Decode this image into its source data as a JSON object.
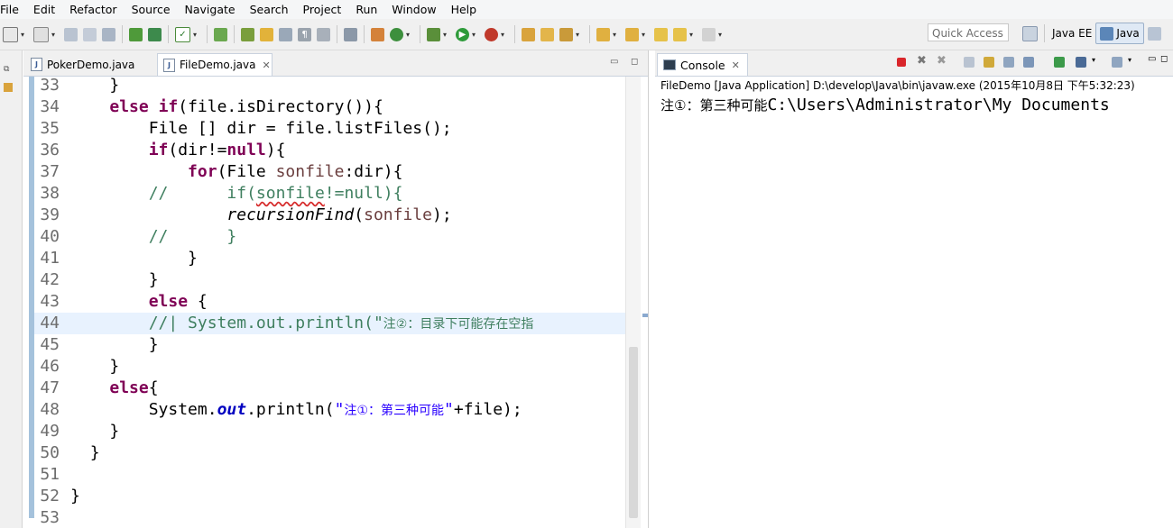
{
  "menu": [
    "File",
    "Edit",
    "Refactor",
    "Source",
    "Navigate",
    "Search",
    "Project",
    "Run",
    "Window",
    "Help"
  ],
  "toolbar": {
    "quick_access_placeholder": "Quick Access",
    "perspectives": [
      {
        "label": "Java EE",
        "active": false
      },
      {
        "label": "Java",
        "active": true
      }
    ]
  },
  "editor": {
    "tabs": [
      {
        "label": "PokerDemo.java",
        "active": false
      },
      {
        "label": "FileDemo.java",
        "active": true
      }
    ],
    "current_line": 44,
    "lines": [
      {
        "n": "33",
        "indent": "    ",
        "tokens": [
          {
            "t": "}"
          }
        ]
      },
      {
        "n": "34",
        "indent": "    ",
        "tokens": [
          {
            "t": "else",
            "c": "kw"
          },
          {
            "t": " "
          },
          {
            "t": "if",
            "c": "kw"
          },
          {
            "t": "(file.isDirectory()){"
          }
        ]
      },
      {
        "n": "35",
        "indent": "        ",
        "tokens": [
          {
            "t": "File [] dir = file.listFiles();"
          }
        ]
      },
      {
        "n": "36",
        "indent": "        ",
        "tokens": [
          {
            "t": "if",
            "c": "kw"
          },
          {
            "t": "(dir!="
          },
          {
            "t": "null",
            "c": "kw"
          },
          {
            "t": "){"
          }
        ]
      },
      {
        "n": "37",
        "indent": "            ",
        "tokens": [
          {
            "t": "for",
            "c": "kw"
          },
          {
            "t": "(File "
          },
          {
            "t": "sonfile",
            "c": "varr"
          },
          {
            "t": ":dir){"
          }
        ]
      },
      {
        "n": "38",
        "indent": "        ",
        "tokens": [
          {
            "t": "//      if(",
            "c": "cm"
          },
          {
            "t": "sonfile",
            "c": "cm sq"
          },
          {
            "t": "!=null){",
            "c": "cm"
          }
        ]
      },
      {
        "n": "39",
        "indent": "                ",
        "tokens": [
          {
            "t": "recursionFind",
            "c": "mth"
          },
          {
            "t": "("
          },
          {
            "t": "sonfile",
            "c": "varr"
          },
          {
            "t": ");"
          }
        ]
      },
      {
        "n": "40",
        "indent": "        ",
        "tokens": [
          {
            "t": "//      }",
            "c": "cm"
          }
        ]
      },
      {
        "n": "41",
        "indent": "            ",
        "tokens": [
          {
            "t": "}"
          }
        ]
      },
      {
        "n": "42",
        "indent": "        ",
        "tokens": [
          {
            "t": "}"
          }
        ]
      },
      {
        "n": "43",
        "indent": "        ",
        "tokens": [
          {
            "t": "else",
            "c": "kw"
          },
          {
            "t": " {"
          }
        ]
      },
      {
        "n": "44",
        "indent": "        ",
        "tokens": [
          {
            "t": "//| System.out.println(\"",
            "c": "cm"
          },
          {
            "t": "注②：目录下可能存在空指",
            "c": "cm cjk"
          }
        ]
      },
      {
        "n": "45",
        "indent": "        ",
        "tokens": [
          {
            "t": "}"
          }
        ]
      },
      {
        "n": "46",
        "indent": "    ",
        "tokens": [
          {
            "t": "}"
          }
        ]
      },
      {
        "n": "47",
        "indent": "    ",
        "tokens": [
          {
            "t": "else",
            "c": "kw"
          },
          {
            "t": "{"
          }
        ]
      },
      {
        "n": "48",
        "indent": "        ",
        "tokens": [
          {
            "t": "System."
          },
          {
            "t": "out",
            "c": "fld"
          },
          {
            "t": ".println("
          },
          {
            "t": "\"",
            "c": "str"
          },
          {
            "t": "注①：第三种可能",
            "c": "str cjk"
          },
          {
            "t": "\"",
            "c": "str"
          },
          {
            "t": "+file);"
          }
        ]
      },
      {
        "n": "49",
        "indent": "    ",
        "tokens": [
          {
            "t": "}"
          }
        ]
      },
      {
        "n": "50",
        "indent": "  ",
        "tokens": [
          {
            "t": "}"
          }
        ]
      },
      {
        "n": "51",
        "indent": "",
        "tokens": []
      },
      {
        "n": "52",
        "indent": "",
        "tokens": [
          {
            "t": "}"
          }
        ]
      },
      {
        "n": "53",
        "indent": "",
        "tokens": []
      }
    ]
  },
  "console": {
    "tab_label": "Console",
    "description": "FileDemo [Java Application] D:\\develop\\Java\\bin\\javaw.exe (2015年10月8日 下午5:32:23)",
    "output_cjk": "注①：第三种可能",
    "output_path": "C:\\Users\\Administrator\\My Documents"
  }
}
